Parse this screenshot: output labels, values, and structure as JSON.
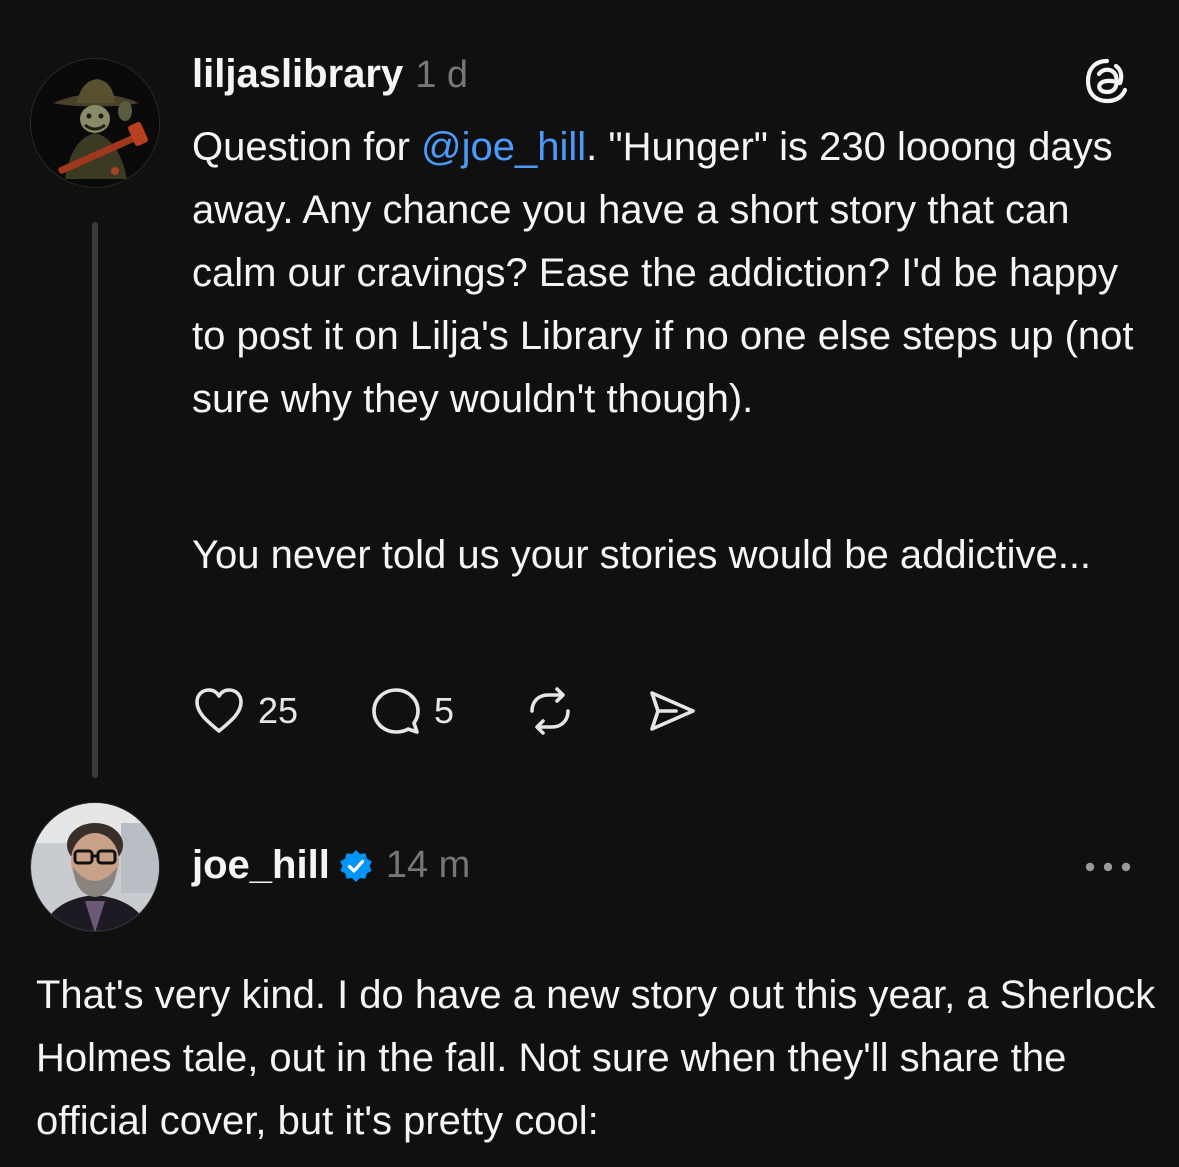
{
  "post1": {
    "username": "liljaslibrary",
    "time": "1 d",
    "text_before_mention": "Question for ",
    "mention": "@joe_hill",
    "text_after_mention": ". \"Hunger\" is 230 looong days away. Any chance you have a short story that can calm our cravings? Ease the addiction? I'd be happy to post it on Lilja's Library if no one else steps up (not sure why they wouldn't though).",
    "paragraph2": "You never told us your stories would be addictive...",
    "likes": "25",
    "replies": "5",
    "icons": {
      "avatar": "avatar-liljaslibrary",
      "logo": "threads-logo-icon",
      "like": "heart-icon",
      "reply": "comment-icon",
      "repost": "repost-icon",
      "share": "send-icon"
    }
  },
  "post2": {
    "username": "joe_hill",
    "verified": true,
    "time": "14 m",
    "text": "That's very kind. I do have a new story out this year, a Sherlock Holmes tale, out in the fall. Not sure when they'll share the official cover, but it's pretty cool:",
    "icons": {
      "avatar": "avatar-joe-hill",
      "badge": "verified-badge-icon",
      "more": "more-options-icon"
    }
  },
  "colors": {
    "background": "#101010",
    "text": "#f3f5f7",
    "muted": "#777777",
    "mention": "#4c9bfb",
    "verified": "#0095f6",
    "thread_line": "#3b3b3b"
  }
}
